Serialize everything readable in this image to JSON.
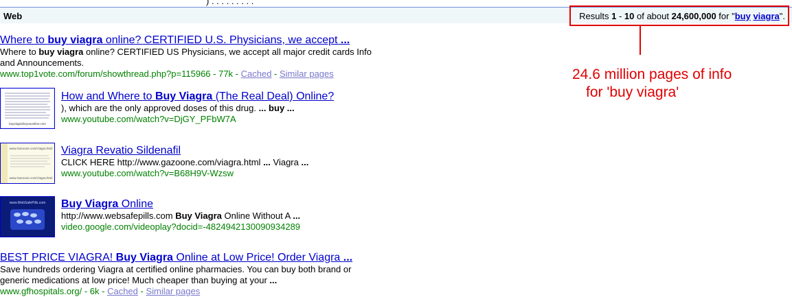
{
  "header": {
    "section_label": "Web",
    "stats": {
      "prefix": "Results ",
      "from": "1",
      "sep": " - ",
      "to": "10",
      "mid": " of about ",
      "total": "24,600,000",
      "for": " for \"",
      "q1": "buy",
      "q2": "viagra",
      "end": "\"."
    }
  },
  "annotation": {
    "line1": "24.6 million pages of info",
    "line2": "for 'buy viagra'",
    "color": "#e00000"
  },
  "results": [
    {
      "title_pre": "Where to ",
      "title_bold": "buy viagra",
      "title_post": " online? CERTIFIED U.S. Physicians, we accept ",
      "title_ellipsis": "...",
      "snippet_pre": "Where to ",
      "snippet_bold": "buy viagra",
      "snippet_post": " online? CERTIFIED US Physicians, we accept all major credit cards Info and Announcements.",
      "url": "www.top1vote.com/forum/showthread.php?p=115966 - 77k",
      "cached": "Cached",
      "similar": "Similar pages"
    },
    {
      "title_pre": "How and Where to ",
      "title_bold": "Buy Viagra",
      "title_post": " (The Real Deal) Online?",
      "snippet_pre": "), which are the only approved doses of this drug. ",
      "snippet_bold": "... buy ...",
      "url": "www.youtube.com/watch?v=DjGY_PFbW7A"
    },
    {
      "title": "Viagra Revatio Sildenafil",
      "snippet_pre": "CLICK HERE http://www.gazoone.com/viagra.html ",
      "snippet_bold1": "...",
      "snippet_mid": " Viagra ",
      "snippet_bold2": "...",
      "url": "www.youtube.com/watch?v=B68H9V-Wzsw"
    },
    {
      "title_bold": "Buy Viagra",
      "title_post": " Online",
      "snippet_pre": "http://www.websafepills.com ",
      "snippet_bold": "Buy Viagra",
      "snippet_post": " Online Without A ",
      "snippet_ellipsis": "...",
      "url": "video.google.com/videoplay?docid=-4824942130090934289"
    },
    {
      "title_pre": "BEST PRICE VIAGRA! ",
      "title_bold": "Buy Viagra",
      "title_post": " Online at Low Price! Order Viagra ",
      "title_ellipsis": "...",
      "snippet": "Save hundreds ordering Viagra at certified online pharmacies. You can buy both brand or generic medications at low price! Much cheaper than buying at your ",
      "snippet_ellipsis": "...",
      "url": "www.gfhospitals.org/ - 6k",
      "cached": "Cached",
      "similar": "Similar pages"
    }
  ],
  "thumbnails": {
    "t1": {
      "caption": "buyviagraforyouonline.com"
    },
    "t2": {
      "caption_top": "www.Gazoone.com/Viagra.html",
      "caption_bottom": "www.Gazoone.com/Viagra.html"
    },
    "t3": {
      "caption": "www.WebSafePills.com"
    }
  }
}
